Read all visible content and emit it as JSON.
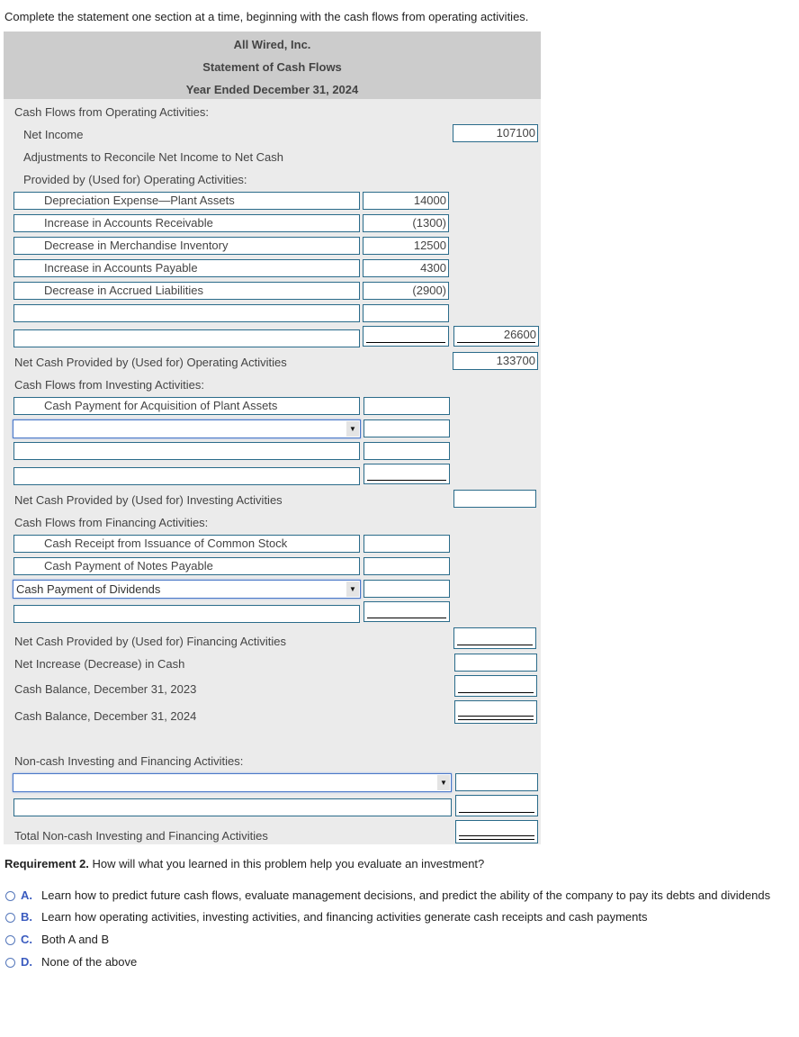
{
  "instruction": "Complete the statement one section at a time, beginning with the cash flows from operating activities.",
  "statement": {
    "company": "All Wired, Inc.",
    "title": "Statement of Cash Flows",
    "period": "Year Ended December 31, 2024"
  },
  "operating": {
    "heading": "Cash Flows from Operating Activities:",
    "net_income_label": "Net Income",
    "net_income_value": "107100",
    "adjustments_line1": "Adjustments to Reconcile Net Income to Net Cash",
    "adjustments_line2": "Provided by (Used for) Operating Activities:",
    "rows": [
      {
        "label": "Depreciation Expense—Plant Assets",
        "value": "14000"
      },
      {
        "label": "Increase in Accounts Receivable",
        "value": "(1300)"
      },
      {
        "label": "Decrease in Merchandise Inventory",
        "value": "12500"
      },
      {
        "label": "Increase in Accounts Payable",
        "value": "4300"
      },
      {
        "label": "Decrease in Accrued Liabilities",
        "value": "(2900)"
      },
      {
        "label": "",
        "value": ""
      },
      {
        "label": "",
        "value": ""
      }
    ],
    "total_adjustments": "26600",
    "net_cash_label": "Net Cash Provided by (Used for) Operating Activities",
    "net_cash_value": "133700"
  },
  "investing": {
    "heading": "Cash Flows from Investing Activities:",
    "rows": [
      {
        "label": "Cash Payment for Acquisition of Plant Assets",
        "value": ""
      },
      {
        "label": "",
        "value": "",
        "dropdown": true
      },
      {
        "label": "",
        "value": ""
      },
      {
        "label": "",
        "value": ""
      }
    ],
    "net_cash_label": "Net Cash Provided by (Used for) Investing Activities",
    "net_cash_value": ""
  },
  "financing": {
    "heading": "Cash Flows from Financing Activities:",
    "rows": [
      {
        "label": "Cash Receipt from Issuance of Common Stock",
        "value": ""
      },
      {
        "label": "Cash Payment of Notes Payable",
        "value": ""
      },
      {
        "label": "Cash Payment of Dividends",
        "value": "",
        "dropdown": true
      },
      {
        "label": "",
        "value": ""
      }
    ],
    "net_cash_label": "Net Cash Provided by (Used for) Financing Activities",
    "net_cash_value": ""
  },
  "summary": {
    "net_increase_label": "Net Increase (Decrease) in Cash",
    "net_increase_value": "",
    "begin_balance_label": "Cash Balance, December 31, 2023",
    "begin_balance_value": "",
    "end_balance_label": "Cash Balance, December 31, 2024",
    "end_balance_value": ""
  },
  "noncash": {
    "heading": "Non-cash Investing and Financing Activities:",
    "rows": [
      {
        "label": "",
        "value": "",
        "dropdown": true
      },
      {
        "label": "",
        "value": ""
      }
    ],
    "total_label": "Total Non-cash Investing and Financing Activities",
    "total_value": ""
  },
  "dropdown_arrow_icon": "▼",
  "requirement2": {
    "label": "Requirement 2.",
    "question": " How will what you learned in this problem help you evaluate an investment?",
    "options": [
      {
        "letter": "A.",
        "text": "Learn how to predict future cash flows, evaluate management decisions, and predict the ability of the company to pay its debts and dividends"
      },
      {
        "letter": "B.",
        "text": "Learn how operating activities, investing activities, and financing activities generate cash receipts and cash payments"
      },
      {
        "letter": "C.",
        "text": "Both A and B"
      },
      {
        "letter": "D.",
        "text": "None of the above"
      }
    ]
  }
}
